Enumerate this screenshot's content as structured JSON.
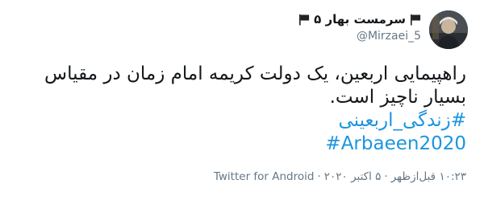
{
  "user": {
    "display_name": "سرمست بهار ۵",
    "handle": "@Mirzaei_5"
  },
  "tweet": {
    "line1": "راهپیمایی اربعین، یک دولت کریمه امام زمان در مقیاس",
    "line2": "بسیار ناچیز است.",
    "hashtag1": "#زندگی_اربعینی",
    "hashtag2": "#Arbaeen2020"
  },
  "meta": {
    "time": "۱۰:۲۳ قبل‌ازظهر",
    "date": "۵ اکتبر ۲۰۲۰",
    "source": "Twitter for Android",
    "separator": "·"
  },
  "colors": {
    "link": "#1b95e0",
    "text": "#14171a",
    "muted": "#657786"
  },
  "icons": {
    "flag_left": "flag-icon",
    "flag_right": "flag-icon"
  }
}
